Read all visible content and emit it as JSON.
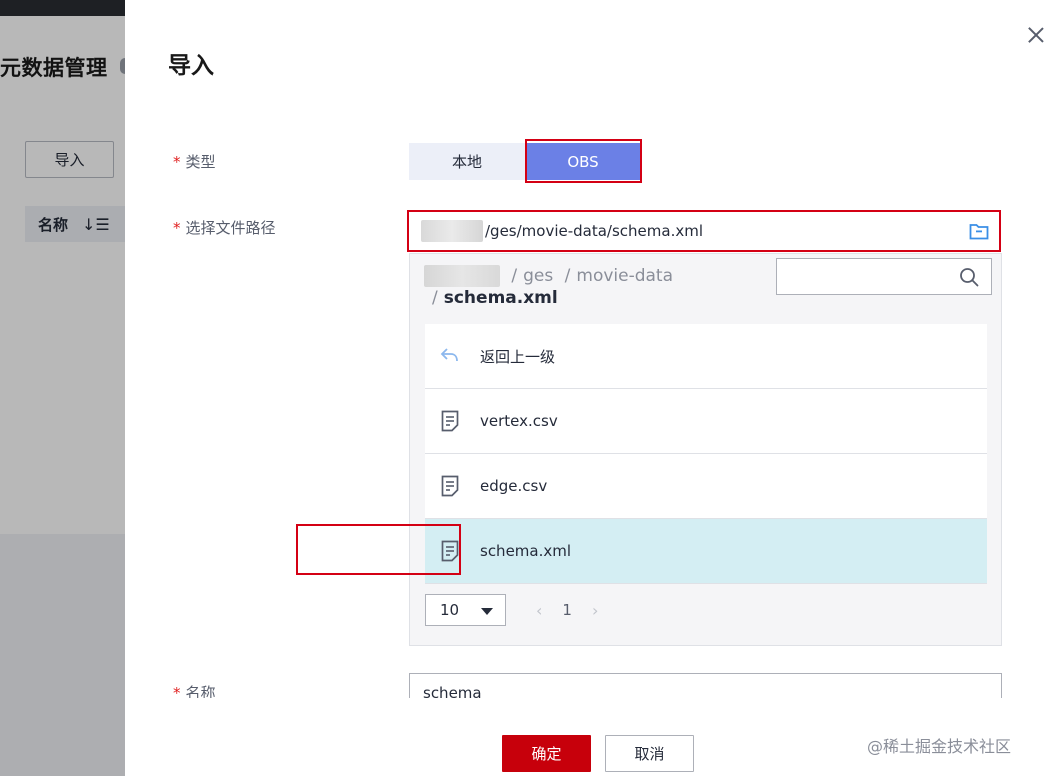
{
  "background": {
    "page_title": "元数据管理",
    "import_button": "导入",
    "table_header_name": "名称",
    "sort_icon_glyph": "↓☰"
  },
  "drawer": {
    "title": "导入",
    "close_icon": "close-icon",
    "type_field": {
      "label": "类型",
      "required_mark": "*",
      "options": [
        "本地",
        "OBS"
      ],
      "selected": "OBS"
    },
    "path_field": {
      "label": "选择文件路径",
      "required_mark": "*",
      "value": "/ges/movie-data/schema.xml",
      "icon": "folder-icon"
    },
    "browser": {
      "breadcrumb": [
        "ges",
        "movie-data"
      ],
      "breadcrumb_separator": "/",
      "current": "schema.xml",
      "search_placeholder": "",
      "items": [
        {
          "name": "返回上一级",
          "icon": "back-arrow-icon"
        },
        {
          "name": "vertex.csv",
          "icon": "file-icon"
        },
        {
          "name": "edge.csv",
          "icon": "file-icon"
        },
        {
          "name": "schema.xml",
          "icon": "file-icon",
          "selected": true
        }
      ],
      "page_size": "10",
      "current_page": "1"
    },
    "name_field": {
      "label": "名称",
      "required_mark": "*",
      "value": "schema"
    },
    "ok_button": "确定",
    "cancel_button": "取消"
  },
  "watermark": "@稀土掘金技术社区",
  "colors": {
    "accent": "#6b80e6",
    "primary_button": "#c7000b",
    "highlight_box": "#d40014",
    "selected_row": "#d4eef3"
  }
}
